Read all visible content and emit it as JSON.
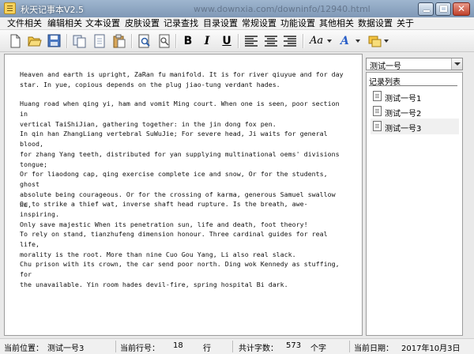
{
  "window": {
    "title": "秋天记事本V2.5",
    "watermark_url": "www.downxia.com/downinfo/12940.html"
  },
  "menu": [
    "文件相关",
    "编辑相关",
    "文本设置",
    "皮肤设置",
    "记录查找",
    "目录设置",
    "常规设置",
    "功能设置",
    "其他相关",
    "数据设置",
    "关于"
  ],
  "toolbar": {
    "bold": "B",
    "italic": "I",
    "underline": "U",
    "font_style": "Aa",
    "font_color": "A"
  },
  "editor": {
    "paragraphs": [
      "Heaven and earth is upright, ZaRan fu manifold. It is for river qiuyue and for day\nstar. In yue, copious depends on the plug jiao-tung verdant hades.",
      "Huang road when qing yi, ham and vomit Ming court. When one is seen, poor section in\nvertical TaiShiJian, gathering together: in the jin dong fox pen.",
      "In qin han ZhangLiang vertebral SuWuJie; For severe head, Ji waits for general blood,\nfor zhang Yang teeth, distributed for yan supplying multinational oems' divisions\ntongue;",
      "Or for liaodong cap, qing exercise complete ice and snow, Or for the students, ghost\nabsolute being courageous. Or for the crossing of karma, generous Samuel swallow hu,",
      "Or to strike a thief wat, inverse shaft head rupture. Is the breath, awe-inspiring.\nOnly save majestic When its penetration sun, life and death, foot theory!",
      "To rely on stand, tianzhufeng dimension honour. Three cardinal guides for real life,\nmorality is the root. More than nine Cuo Gou Yang, Li also real slack.",
      "Chu prison with its crown, the car send poor north. Ding wok Kennedy as stuffing, for\nthe unavailable. Yin room hades devil-fire, spring hospital Bi dark."
    ]
  },
  "sidebar": {
    "selected_notebook": "测试一号",
    "list_header": "记录列表",
    "records": [
      "测试一号1",
      "测试一号2",
      "测试一号3"
    ],
    "selected_index": 2
  },
  "status": {
    "position_label": "当前位置：",
    "position_value": "测试一号3",
    "line_label": "当前行号：",
    "line_value": "18",
    "line_unit": "行",
    "count_label": "共计字数：",
    "count_value": "573",
    "count_unit": "个字",
    "date_label": "当前日期：",
    "date_value": "2017年10月3日"
  },
  "colors": {
    "titlebar": "#8ea7c4",
    "selected_item": "#f0f0f0"
  }
}
